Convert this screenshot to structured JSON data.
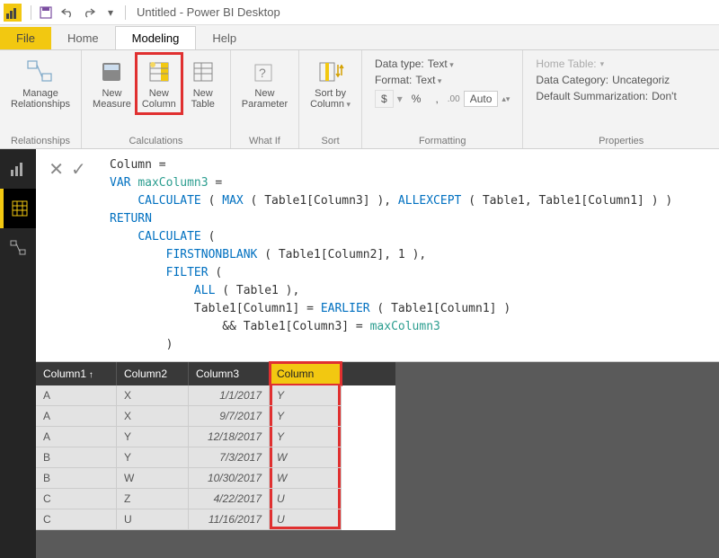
{
  "titlebar": {
    "app_title": "Untitled - Power BI Desktop"
  },
  "tabs": {
    "file": "File",
    "home": "Home",
    "modeling": "Modeling",
    "help": "Help"
  },
  "ribbon": {
    "relationships": {
      "label": "Relationships",
      "manage": "Manage\nRelationships"
    },
    "calculations": {
      "label": "Calculations",
      "new_measure": "New\nMeasure",
      "new_column": "New\nColumn",
      "new_table": "New\nTable"
    },
    "whatif": {
      "label": "What If",
      "new_parameter": "New\nParameter"
    },
    "sort": {
      "label": "Sort",
      "sort_by": "Sort by\nColumn"
    },
    "formatting": {
      "label": "Formatting",
      "datatype_lbl": "Data type:",
      "datatype_val": "Text",
      "format_lbl": "Format:",
      "format_val": "Text",
      "currency": "$",
      "percent": "%",
      "comma": ",",
      "decimals": "Auto"
    },
    "properties": {
      "label": "Properties",
      "home_table_lbl": "Home Table:",
      "data_category_lbl": "Data Category:",
      "data_category_val": "Uncategoriz",
      "summarization_lbl": "Default Summarization:",
      "summarization_val": "Don't"
    }
  },
  "formula": {
    "line1": "Column =",
    "var_kw": "VAR",
    "var_name": "maxColumn3",
    "calc": "CALCULATE",
    "max": "MAX",
    "allexcept": "ALLEXCEPT",
    "return_kw": "RETURN",
    "firstnonblank": "FIRSTNONBLANK",
    "filter": "FILTER",
    "all": "ALL",
    "earlier": "EARLIER",
    "tbl": "Table1",
    "c1": "Table1[Column1]",
    "c2": "Table1[Column2]",
    "c3": "Table1[Column3]"
  },
  "grid": {
    "headers": [
      "Column1",
      "Column2",
      "Column3",
      "Column"
    ],
    "rows": [
      [
        "A",
        "X",
        "1/1/2017",
        "Y"
      ],
      [
        "A",
        "X",
        "9/7/2017",
        "Y"
      ],
      [
        "A",
        "Y",
        "12/18/2017",
        "Y"
      ],
      [
        "B",
        "Y",
        "7/3/2017",
        "W"
      ],
      [
        "B",
        "W",
        "10/30/2017",
        "W"
      ],
      [
        "C",
        "Z",
        "4/22/2017",
        "U"
      ],
      [
        "C",
        "U",
        "11/16/2017",
        "U"
      ]
    ]
  }
}
